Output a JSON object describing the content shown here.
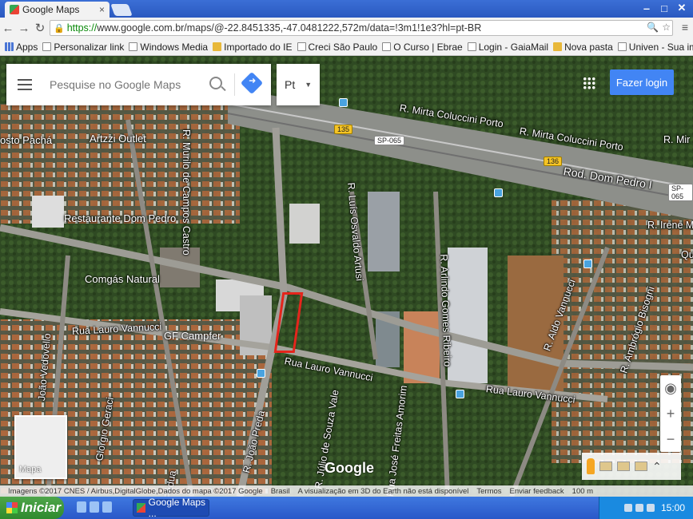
{
  "browser": {
    "tab_title": "Google Maps",
    "close_glyph": "×",
    "url_scheme": "https://",
    "url_rest": "www.google.com.br/maps/@-22.8451335,-47.0481222,572m/data=!3m1!1e3?hl=pt-BR",
    "window_buttons": [
      "‒",
      "□",
      "✕"
    ]
  },
  "bookmarks": [
    {
      "label": "Apps",
      "kind": "apps"
    },
    {
      "label": "Personalizar link",
      "kind": "page"
    },
    {
      "label": "Windows Media",
      "kind": "page"
    },
    {
      "label": "Importado do IE",
      "kind": "folder"
    },
    {
      "label": "Creci São Paulo",
      "kind": "page"
    },
    {
      "label": "O Curso | Ebrae",
      "kind": "page"
    },
    {
      "label": "Login - GaiaMail",
      "kind": "page"
    },
    {
      "label": "Nova pasta",
      "kind": "folder"
    },
    {
      "label": "Univen - Sua im",
      "kind": "page"
    }
  ],
  "map": {
    "search_placeholder": "Pesquise no Google Maps",
    "language": "Pt",
    "signin_label": "Fazer login",
    "minimap_label": "Mapa",
    "google_logo": "Google",
    "zoom_in": "+",
    "zoom_out": "−",
    "expand_glyph": "⌃",
    "streets": [
      "R. Mirta Coluccini Porto",
      "R. Mirta Coluccini Porto",
      "R. Mir",
      "Rod. Dom Pedro I",
      "R. Murilo de Campos Castro",
      "R. Luís Osvaldo Artusi",
      "R. Arlindo Gomes Ribeiro",
      "R. Irene Mi",
      "R. Aldo Vannucci",
      "R. Ambrógio Bisogni",
      "Rua Lauro Vannucci",
      "Rua Lauro Vannucci",
      "Rua Lauro Vannucci",
      "R. João Preda",
      "R. Júlio de Souza Vale",
      "Rua José Freitas Amorim",
      "João Vedovello",
      "Giorgio Geraci",
      "Pádua",
      "Qu"
    ],
    "places": [
      "osto Pachá",
      "Artzzi Outlet",
      "Restaurante Dom Pedro",
      "Comgás Natural",
      "GF Campfer"
    ],
    "shields": [
      "135",
      "SP-065",
      "136",
      "SP-065"
    ],
    "footer": [
      "Imagens ©2017 CNES / Airbus,DigitalGlobe,Dados do mapa ©2017 Google",
      "Brasil",
      "A visualização em 3D do Earth não está disponível",
      "Termos",
      "Enviar feedback",
      "100 m"
    ]
  },
  "taskbar": {
    "start_label": "Iniciar",
    "task_label": "Google Maps ...",
    "clock": "15:00"
  }
}
